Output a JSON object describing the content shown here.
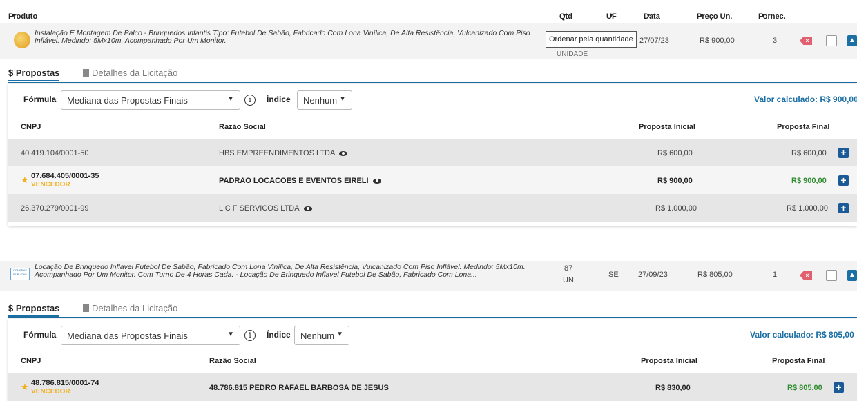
{
  "header": {
    "produto": "Produto",
    "qtd": "Qtd",
    "uf": "UF",
    "data": "Data",
    "preco": "Preço Un.",
    "fornec": "Fornec."
  },
  "tooltip": "Ordenar pela quantidade",
  "items": [
    {
      "description": "Instalação E Montagem De Palco - Brinquedos Infantis Tipo: Futebol De Sabão, Fabricado Com Lona Vinílica, De Alta Resistência, Vulcanizado Com Piso Inflável. Medindo: 5Mx10m. Acompanhado Por Um Monitor.",
      "qtd": "",
      "unit": "UNIDADE",
      "uf": "",
      "date": "27/07/23",
      "price": "R$ 900,00",
      "fornec": "3",
      "tabs": {
        "propostas": "$ Propostas",
        "detalhes": "Detalhes da Licitação"
      },
      "formula_label": "Fórmula",
      "formula_value": "Mediana das Propostas Finais",
      "indice_label": "Índice",
      "indice_value": "Nenhum",
      "calc": "Valor calculado: R$ 900,00",
      "columns": {
        "cnpj": "CNPJ",
        "razao": "Razão Social",
        "inicial": "Proposta Inicial",
        "final": "Proposta Final"
      },
      "rows": [
        {
          "cnpj": "40.419.104/0001-50",
          "razao": "HBS EMPREENDIMENTOS LTDA",
          "inicial": "R$ 600,00",
          "final": "R$ 600,00",
          "winner": ""
        },
        {
          "cnpj": "07.684.405/0001-35",
          "razao": "PADRAO LOCACOES E EVENTOS EIRELI",
          "inicial": "R$ 900,00",
          "final": "R$ 900,00",
          "winner": "VENCEDOR"
        },
        {
          "cnpj": "26.370.279/0001-99",
          "razao": "L C F SERVICOS LTDA",
          "inicial": "R$ 1.000,00",
          "final": "R$ 1.000,00",
          "winner": ""
        }
      ]
    },
    {
      "description": "Locação De Brinquedo Inflavel Futebol De Sabão, Fabricado Com Lona Vinílica, De Alta Resistência, Vulcanizado Com Piso Inflável. Medindo: 5Mx10m. Acompanhado Por Um Monitor. Com Turno De 4 Horas Cada. - Locação De Brinquedo Inflavel Futebol De Sabão, Fabricado Com Lona...",
      "qtd": "87",
      "unit": "UN",
      "uf": "SE",
      "date": "27/09/23",
      "price": "R$ 805,00",
      "fornec": "1",
      "thumb_text": "COMPRAS PÚBLICAS",
      "tabs": {
        "propostas": "$ Propostas",
        "detalhes": "Detalhes da Licitação"
      },
      "formula_label": "Fórmula",
      "formula_value": "Mediana das Propostas Finais",
      "indice_label": "Índice",
      "indice_value": "Nenhum",
      "calc": "Valor calculado: R$ 805,00",
      "columns": {
        "cnpj": "CNPJ",
        "razao": "Razão Social",
        "inicial": "Proposta Inicial",
        "final": "Proposta Final"
      },
      "rows": [
        {
          "cnpj": "48.786.815/0001-74",
          "razao": "48.786.815 PEDRO RAFAEL BARBOSA DE JESUS",
          "inicial": "R$ 830,00",
          "final": "R$ 805,00",
          "winner": "VENCEDOR"
        }
      ]
    }
  ]
}
